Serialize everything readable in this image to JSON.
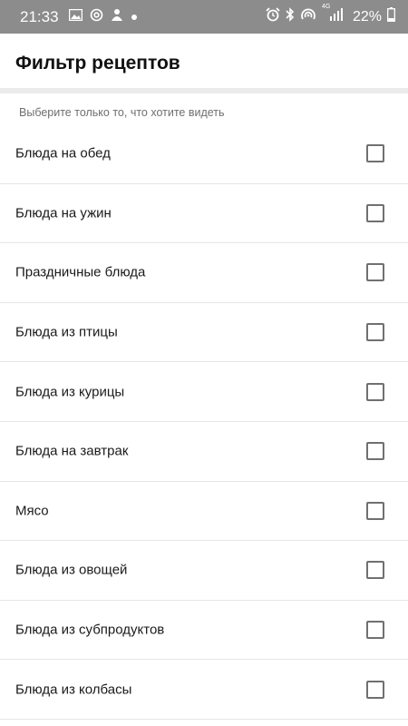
{
  "status_bar": {
    "time": "21:33",
    "battery_percent": "22%",
    "network": "4G",
    "icons": [
      "image-icon",
      "at-icon",
      "notification-icon",
      "dot-icon",
      "alarm-icon",
      "bluetooth-icon",
      "hotspot-icon",
      "signal-icon",
      "battery-icon"
    ]
  },
  "header": {
    "title": "Фильтр рецептов"
  },
  "hint": "Выберите только то, что хотите видеть",
  "filters": [
    {
      "label": "Блюда на обед",
      "checked": false
    },
    {
      "label": "Блюда на ужин",
      "checked": false
    },
    {
      "label": "Праздничные блюда",
      "checked": false
    },
    {
      "label": "Блюда из птицы",
      "checked": false
    },
    {
      "label": "Блюда из курицы",
      "checked": false
    },
    {
      "label": "Блюда на завтрак",
      "checked": false
    },
    {
      "label": "Мясо",
      "checked": false
    },
    {
      "label": "Блюда из овощей",
      "checked": false
    },
    {
      "label": "Блюда из субпродуктов",
      "checked": false
    },
    {
      "label": "Блюда из колбасы",
      "checked": false
    }
  ],
  "colors": {
    "status_bar_bg": "#8c8c8c",
    "divider": "#ebebeb",
    "checkbox_border": "#707070"
  }
}
